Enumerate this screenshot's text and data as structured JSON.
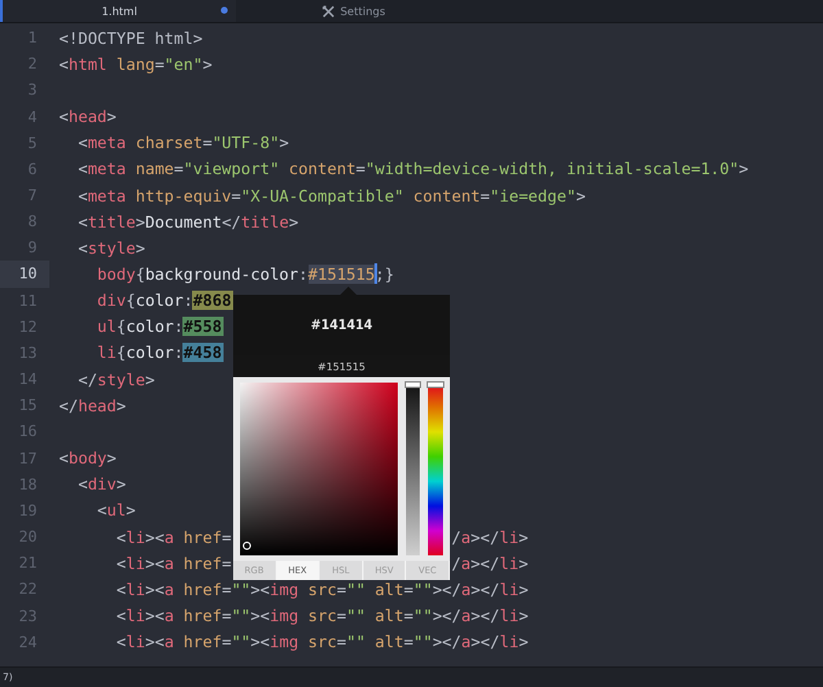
{
  "tabs": [
    {
      "label": "1.html",
      "selected": true,
      "modified": true,
      "kind": "file"
    },
    {
      "label": "Settings",
      "selected": false,
      "modified": false,
      "kind": "settings"
    }
  ],
  "lines": [
    {
      "num": "1",
      "current": false,
      "tokens": [
        {
          "kind": "punct",
          "text": "<!DOCTYPE html>"
        }
      ]
    },
    {
      "num": "2",
      "current": false,
      "tokens": [
        {
          "kind": "punct",
          "text": "<"
        },
        {
          "kind": "tag",
          "text": "html"
        },
        {
          "kind": "attr",
          "text": " lang"
        },
        {
          "kind": "punct",
          "text": "="
        },
        {
          "kind": "string",
          "text": "\"en\""
        },
        {
          "kind": "punct",
          "text": ">"
        }
      ]
    },
    {
      "num": "3",
      "current": false
    },
    {
      "num": "4",
      "current": false,
      "tokens": [
        {
          "kind": "punct",
          "text": "<"
        },
        {
          "kind": "tag",
          "text": "head"
        },
        {
          "kind": "punct",
          "text": ">"
        }
      ]
    },
    {
      "num": "5",
      "current": false,
      "tokens": [
        {
          "kind": "punct",
          "text": "  <"
        },
        {
          "kind": "tag",
          "text": "meta"
        },
        {
          "kind": "attr",
          "text": " charset"
        },
        {
          "kind": "punct",
          "text": "="
        },
        {
          "kind": "string",
          "text": "\"UTF-8\""
        },
        {
          "kind": "punct",
          "text": ">"
        }
      ]
    },
    {
      "num": "6",
      "current": false,
      "tokens": [
        {
          "kind": "punct",
          "text": "  <"
        },
        {
          "kind": "tag",
          "text": "meta"
        },
        {
          "kind": "attr",
          "text": " name"
        },
        {
          "kind": "punct",
          "text": "="
        },
        {
          "kind": "string",
          "text": "\"viewport\""
        },
        {
          "kind": "attr",
          "text": " content"
        },
        {
          "kind": "punct",
          "text": "="
        },
        {
          "kind": "string",
          "text": "\"width=device-width, initial-scale=1.0\""
        },
        {
          "kind": "punct",
          "text": ">"
        }
      ]
    },
    {
      "num": "7",
      "current": false,
      "tokens": [
        {
          "kind": "punct",
          "text": "  <"
        },
        {
          "kind": "tag",
          "text": "meta"
        },
        {
          "kind": "attr",
          "text": " http-equiv"
        },
        {
          "kind": "punct",
          "text": "="
        },
        {
          "kind": "string",
          "text": "\"X-UA-Compatible\""
        },
        {
          "kind": "attr",
          "text": " content"
        },
        {
          "kind": "punct",
          "text": "="
        },
        {
          "kind": "string",
          "text": "\"ie=edge\""
        },
        {
          "kind": "punct",
          "text": ">"
        }
      ]
    },
    {
      "num": "8",
      "current": false,
      "tokens": [
        {
          "kind": "punct",
          "text": "  <"
        },
        {
          "kind": "tag",
          "text": "title"
        },
        {
          "kind": "punct",
          "text": ">"
        },
        {
          "kind": "text",
          "text": "Document"
        },
        {
          "kind": "punct",
          "text": "</"
        },
        {
          "kind": "tag",
          "text": "title"
        },
        {
          "kind": "punct",
          "text": ">"
        }
      ]
    },
    {
      "num": "9",
      "current": false,
      "tokens": [
        {
          "kind": "punct",
          "text": "  <"
        },
        {
          "kind": "tag",
          "text": "style"
        },
        {
          "kind": "punct",
          "text": ">"
        }
      ]
    },
    {
      "num": "10",
      "current": true,
      "tokens": [
        {
          "kind": "tag",
          "text": "    body"
        },
        {
          "kind": "punct",
          "text": "{"
        },
        {
          "kind": "text",
          "text": "background-color"
        },
        {
          "kind": "punct",
          "text": ":"
        },
        {
          "kind": "selection",
          "text": "#151515",
          "cursor_after": true
        },
        {
          "kind": "punct",
          "text": ";}"
        }
      ]
    },
    {
      "num": "11",
      "current": false,
      "tokens": [
        {
          "kind": "tag",
          "text": "    div"
        },
        {
          "kind": "punct",
          "text": "{"
        },
        {
          "kind": "text",
          "text": "color"
        },
        {
          "kind": "punct",
          "text": ":"
        },
        {
          "kind": "hex",
          "text": "#868",
          "color": "#868a4c"
        }
      ]
    },
    {
      "num": "12",
      "current": false,
      "tokens": [
        {
          "kind": "tag",
          "text": "    ul"
        },
        {
          "kind": "punct",
          "text": "{"
        },
        {
          "kind": "text",
          "text": "color"
        },
        {
          "kind": "punct",
          "text": ":"
        },
        {
          "kind": "hex",
          "text": "#558",
          "color": "#558c5e"
        }
      ]
    },
    {
      "num": "13",
      "current": false,
      "tokens": [
        {
          "kind": "tag",
          "text": "    li"
        },
        {
          "kind": "punct",
          "text": "{"
        },
        {
          "kind": "text",
          "text": "color"
        },
        {
          "kind": "punct",
          "text": ":"
        },
        {
          "kind": "hex",
          "text": "#458",
          "color": "#45809a"
        }
      ]
    },
    {
      "num": "14",
      "current": false,
      "tokens": [
        {
          "kind": "punct",
          "text": "  </"
        },
        {
          "kind": "tag",
          "text": "style"
        },
        {
          "kind": "punct",
          "text": ">"
        }
      ]
    },
    {
      "num": "15",
      "current": false,
      "tokens": [
        {
          "kind": "punct",
          "text": "</"
        },
        {
          "kind": "tag",
          "text": "head"
        },
        {
          "kind": "punct",
          "text": ">"
        }
      ]
    },
    {
      "num": "16",
      "current": false
    },
    {
      "num": "17",
      "current": false,
      "tokens": [
        {
          "kind": "punct",
          "text": "<"
        },
        {
          "kind": "tag",
          "text": "body"
        },
        {
          "kind": "punct",
          "text": ">"
        }
      ]
    },
    {
      "num": "18",
      "current": false,
      "tokens": [
        {
          "kind": "punct",
          "text": "  <"
        },
        {
          "kind": "tag",
          "text": "div"
        },
        {
          "kind": "punct",
          "text": ">"
        }
      ]
    },
    {
      "num": "19",
      "current": false,
      "tokens": [
        {
          "kind": "punct",
          "text": "    <"
        },
        {
          "kind": "tag",
          "text": "ul"
        },
        {
          "kind": "punct",
          "text": ">"
        }
      ]
    },
    {
      "num": "20",
      "current": false,
      "tokens": [
        {
          "kind": "punct",
          "text": "      <"
        },
        {
          "kind": "tag",
          "text": "li"
        },
        {
          "kind": "punct",
          "text": "><"
        },
        {
          "kind": "tag",
          "text": "a"
        },
        {
          "kind": "attr",
          "text": " href"
        },
        {
          "kind": "punct",
          "text": "="
        }
      ],
      "tail": [
        {
          "kind": "punct",
          "text": "/"
        },
        {
          "kind": "tag",
          "text": "a"
        },
        {
          "kind": "punct",
          "text": "></"
        },
        {
          "kind": "tag",
          "text": "li"
        },
        {
          "kind": "punct",
          "text": ">"
        }
      ]
    },
    {
      "num": "21",
      "current": false,
      "tokens": [
        {
          "kind": "punct",
          "text": "      <"
        },
        {
          "kind": "tag",
          "text": "li"
        },
        {
          "kind": "punct",
          "text": "><"
        },
        {
          "kind": "tag",
          "text": "a"
        },
        {
          "kind": "attr",
          "text": " href"
        },
        {
          "kind": "punct",
          "text": "="
        }
      ],
      "tail": [
        {
          "kind": "punct",
          "text": "/"
        },
        {
          "kind": "tag",
          "text": "a"
        },
        {
          "kind": "punct",
          "text": "></"
        },
        {
          "kind": "tag",
          "text": "li"
        },
        {
          "kind": "punct",
          "text": ">"
        }
      ]
    },
    {
      "num": "22",
      "current": false,
      "tokens": [
        {
          "kind": "punct",
          "text": "      <"
        },
        {
          "kind": "tag",
          "text": "li"
        },
        {
          "kind": "punct",
          "text": "><"
        },
        {
          "kind": "tag",
          "text": "a"
        },
        {
          "kind": "attr",
          "text": " href"
        },
        {
          "kind": "punct",
          "text": "="
        },
        {
          "kind": "string",
          "text": "\"\""
        },
        {
          "kind": "punct",
          "text": "><"
        },
        {
          "kind": "tag",
          "text": "img"
        },
        {
          "kind": "attr",
          "text": " src"
        },
        {
          "kind": "punct",
          "text": "="
        },
        {
          "kind": "string",
          "text": "\"\""
        },
        {
          "kind": "attr",
          "text": " alt"
        },
        {
          "kind": "punct",
          "text": "="
        },
        {
          "kind": "string",
          "text": "\"\""
        },
        {
          "kind": "punct",
          "text": "></"
        },
        {
          "kind": "tag",
          "text": "a"
        },
        {
          "kind": "punct",
          "text": "></"
        },
        {
          "kind": "tag",
          "text": "li"
        },
        {
          "kind": "punct",
          "text": ">"
        }
      ]
    },
    {
      "num": "23",
      "current": false,
      "tokens": [
        {
          "kind": "punct",
          "text": "      <"
        },
        {
          "kind": "tag",
          "text": "li"
        },
        {
          "kind": "punct",
          "text": "><"
        },
        {
          "kind": "tag",
          "text": "a"
        },
        {
          "kind": "attr",
          "text": " href"
        },
        {
          "kind": "punct",
          "text": "="
        },
        {
          "kind": "string",
          "text": "\"\""
        },
        {
          "kind": "punct",
          "text": "><"
        },
        {
          "kind": "tag",
          "text": "img"
        },
        {
          "kind": "attr",
          "text": " src"
        },
        {
          "kind": "punct",
          "text": "="
        },
        {
          "kind": "string",
          "text": "\"\""
        },
        {
          "kind": "attr",
          "text": " alt"
        },
        {
          "kind": "punct",
          "text": "="
        },
        {
          "kind": "string",
          "text": "\"\""
        },
        {
          "kind": "punct",
          "text": "></"
        },
        {
          "kind": "tag",
          "text": "a"
        },
        {
          "kind": "punct",
          "text": "></"
        },
        {
          "kind": "tag",
          "text": "li"
        },
        {
          "kind": "punct",
          "text": ">"
        }
      ]
    },
    {
      "num": "24",
      "current": false,
      "tokens": [
        {
          "kind": "punct",
          "text": "      <"
        },
        {
          "kind": "tag",
          "text": "li"
        },
        {
          "kind": "punct",
          "text": "><"
        },
        {
          "kind": "tag",
          "text": "a"
        },
        {
          "kind": "attr",
          "text": " href"
        },
        {
          "kind": "punct",
          "text": "="
        },
        {
          "kind": "string",
          "text": "\"\""
        },
        {
          "kind": "punct",
          "text": "><"
        },
        {
          "kind": "tag",
          "text": "img"
        },
        {
          "kind": "attr",
          "text": " src"
        },
        {
          "kind": "punct",
          "text": "="
        },
        {
          "kind": "string",
          "text": "\"\""
        },
        {
          "kind": "attr",
          "text": " alt"
        },
        {
          "kind": "punct",
          "text": "="
        },
        {
          "kind": "string",
          "text": "\"\""
        },
        {
          "kind": "punct",
          "text": "></"
        },
        {
          "kind": "tag",
          "text": "a"
        },
        {
          "kind": "punct",
          "text": "></"
        },
        {
          "kind": "tag",
          "text": "li"
        },
        {
          "kind": "punct",
          "text": ">"
        }
      ]
    }
  ],
  "color_picker": {
    "new_color": "#141414",
    "old_color": "#151515",
    "brightness": {
      "level": 1
    },
    "hue": {
      "level": 0
    },
    "modes": [
      {
        "label": "RGB",
        "selected": false
      },
      {
        "label": "HEX",
        "selected": true
      },
      {
        "label": "HSL",
        "selected": false
      },
      {
        "label": "HSV",
        "selected": false
      },
      {
        "label": "VEC",
        "selected": false
      }
    ]
  },
  "status_bar": {
    "text": "7)"
  }
}
